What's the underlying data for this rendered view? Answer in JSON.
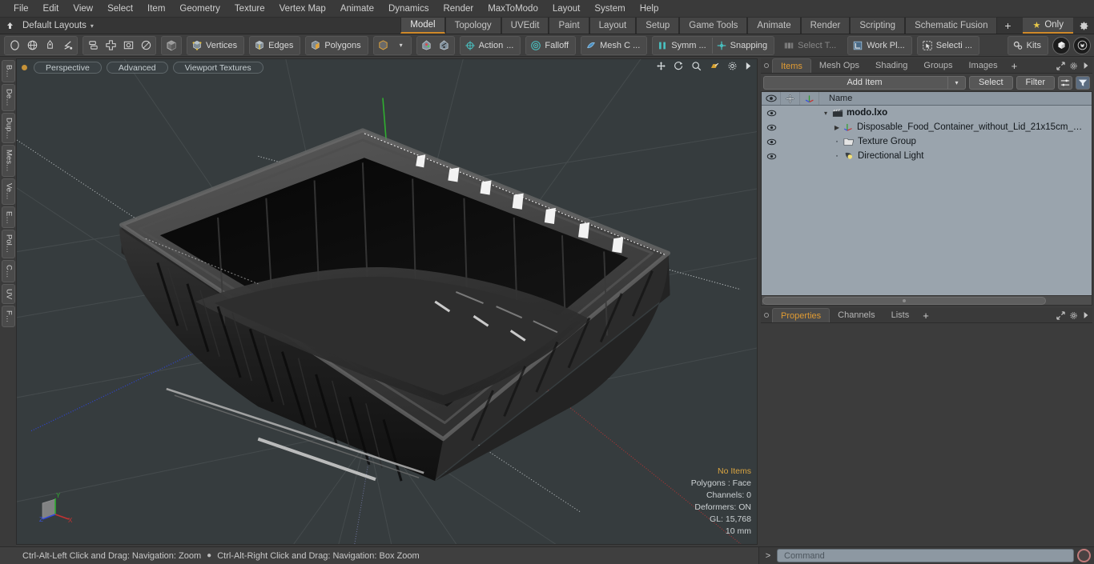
{
  "menu": {
    "items": [
      "File",
      "Edit",
      "View",
      "Select",
      "Item",
      "Geometry",
      "Texture",
      "Vertex Map",
      "Animate",
      "Dynamics",
      "Render",
      "MaxToModo",
      "Layout",
      "System",
      "Help"
    ]
  },
  "layoutbar": {
    "home_icon": "home-arrow-icon",
    "layout_name": "Default Layouts",
    "caret": "▾",
    "tabs": [
      {
        "label": "Model",
        "active": true
      },
      {
        "label": "Topology",
        "active": false
      },
      {
        "label": "UVEdit",
        "active": false
      },
      {
        "label": "Paint",
        "active": false
      },
      {
        "label": "Layout",
        "active": false
      },
      {
        "label": "Setup",
        "active": false
      },
      {
        "label": "Game Tools",
        "active": false
      },
      {
        "label": "Animate",
        "active": false
      },
      {
        "label": "Render",
        "active": false
      },
      {
        "label": "Scripting",
        "active": false
      },
      {
        "label": "Schematic Fusion",
        "active": false
      }
    ],
    "add_tab": "+",
    "only_label": "Only",
    "only_star": "★",
    "gear_icon": "gear-icon"
  },
  "toolbar": {
    "falloff_group": [
      "circle-icon",
      "globe-icon",
      "pen-icon",
      "lasso-icon"
    ],
    "snap_group": [
      "dual-box-icon",
      "cross-icon",
      "square-dot-icon",
      "ellipse-icon"
    ],
    "element_cube": "cube-icon",
    "modes": [
      {
        "label": "Vertices",
        "icon": "vertices-icon"
      },
      {
        "label": "Edges",
        "icon": "edges-icon"
      },
      {
        "label": "Polygons",
        "icon": "polygons-icon"
      }
    ],
    "items_mode_icon": "items-cube-icon",
    "items_dropdown": "▾",
    "center_icon": "center-pivot-icon",
    "pivot_icon": "pivot-icon",
    "action_label": "Action",
    "action_ellipsis": "...",
    "action_icon": "action-center-icon",
    "falloff_label": "Falloff",
    "falloff_icon": "falloff-icon",
    "mesh_constraint_label": "Mesh C ...",
    "mesh_constraint_icon": "mesh-constraint-icon",
    "symmetry_label": "Symm ...",
    "symmetry_icon": "symmetry-icon",
    "snapping_label": "Snapping",
    "snapping_icon": "snapping-icon",
    "select_through_label": "Select T...",
    "select_through_icon": "select-through-icon",
    "work_plane_label": "Work Pl...",
    "work_plane_icon": "work-plane-icon",
    "selection_label": "Selecti ...",
    "selection_icon": "selection-set-icon",
    "kits_label": "Kits",
    "kits_icon": "kits-gear-icon",
    "modo_logo": "modo-cube-logo",
    "unreal_logo": "unreal-logo"
  },
  "left_vtabs": [
    "B…",
    "De…",
    "Dup…",
    "Mes…",
    "Ve…",
    "E…",
    "Pol…",
    "C…",
    "UV",
    "F…"
  ],
  "viewport": {
    "pills": [
      "Perspective",
      "Advanced",
      "Viewport Textures"
    ],
    "indicator_dot": "active-viewport-dot",
    "tools": [
      "move-icon",
      "rotate-icon",
      "zoom-icon",
      "fit-icon",
      "settings-gear-icon",
      "expand-arrow-icon"
    ],
    "background_color": "#363c3e",
    "stats": {
      "no_items": "No Items",
      "polygons": "Polygons : Face",
      "channels": "Channels: 0",
      "deformers": "Deformers: ON",
      "gl": "GL: 15,768",
      "scale": "10 mm"
    },
    "axis": {
      "x": "X",
      "y": "Y",
      "z": "Z",
      "x_color": "#c43232",
      "y_color": "#2fae2f",
      "z_color": "#2f46d8"
    }
  },
  "right_panel": {
    "top_tabs": [
      {
        "label": "Items",
        "active": true
      },
      {
        "label": "Mesh Ops",
        "active": false
      },
      {
        "label": "Shading",
        "active": false
      },
      {
        "label": "Groups",
        "active": false
      },
      {
        "label": "Images",
        "active": false
      }
    ],
    "top_tabs_plus": "+",
    "tools": {
      "add_item": "Add Item",
      "add_item_caret": "▾",
      "select": "Select",
      "filter": "Filter",
      "list_icon": "list-options-icon",
      "funnel_icon": "funnel-icon"
    },
    "list_header": {
      "eye_icon": "eye-icon",
      "lock_icon": "move-lock-icon",
      "axis_icon": "axis-icon",
      "name": "Name"
    },
    "items": [
      {
        "label": "modo.lxo",
        "icon": "scene-clapper-icon",
        "indent": 0,
        "bold": true,
        "twisty": "▾",
        "eye": true
      },
      {
        "label": "Disposable_Food_Container_without_Lid_21x15cm_…",
        "icon": "mesh-axis-icon",
        "indent": 1,
        "bold": false,
        "twisty": "▶",
        "eye": true
      },
      {
        "label": "Texture Group",
        "icon": "folder-icon",
        "indent": 1,
        "bold": false,
        "twisty": "",
        "eye": true
      },
      {
        "label": "Directional Light",
        "icon": "light-icon",
        "indent": 1,
        "bold": false,
        "twisty": "",
        "eye": true
      }
    ],
    "bottom_tabs": [
      {
        "label": "Properties",
        "active": true
      },
      {
        "label": "Channels",
        "active": false
      },
      {
        "label": "Lists",
        "active": false
      }
    ],
    "bottom_tabs_plus": "+"
  },
  "statusbar": {
    "hint_left": "Ctrl-Alt-Left Click and Drag: Navigation: Zoom",
    "hint_bullet": "●",
    "hint_right": "Ctrl-Alt-Right Click and Drag: Navigation: Box Zoom",
    "command_arrow": ">",
    "command_placeholder": "Command",
    "command_value": "",
    "record_icon": "record-circle-icon"
  }
}
